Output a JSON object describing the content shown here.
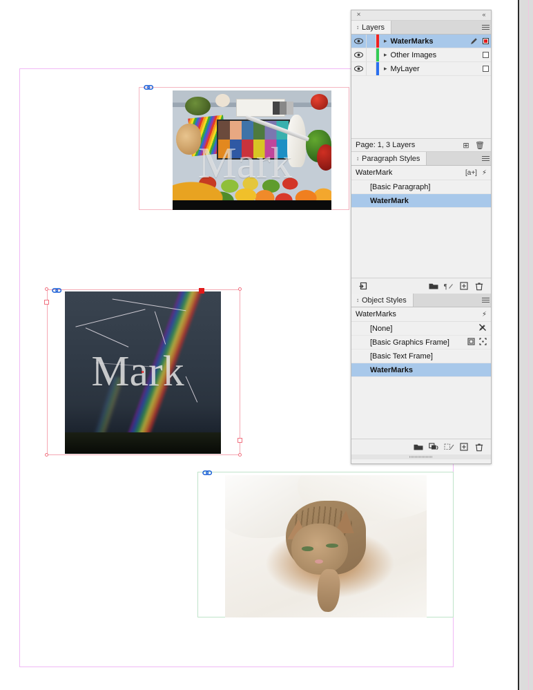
{
  "document": {
    "page_label": "Page: 1, 3 Layers"
  },
  "canvas": {
    "frames": [
      {
        "name": "food-colorchecker-image",
        "watermark": "Mark",
        "frame_color": "#f5b5c0"
      },
      {
        "name": "lightning-rainbow-image",
        "watermark": "Mark",
        "frame_color": "#f5a7b2"
      },
      {
        "name": "cat-on-bed-image",
        "watermark": "",
        "frame_color": "#bfe3c9"
      }
    ]
  },
  "panel": {
    "close_label": "×",
    "collapse_label": "«",
    "layers": {
      "tab_label": "Layers",
      "menu_icon": "hamburger-icon",
      "rows": [
        {
          "label": "WaterMarks",
          "color": "#ee2222",
          "selected": true,
          "visible": true,
          "has_pen": true,
          "target_filled": true
        },
        {
          "label": "Other Images",
          "color": "#33cc55",
          "selected": false,
          "visible": true,
          "has_pen": false,
          "target_filled": false
        },
        {
          "label": "MyLayer",
          "color": "#2a6ff0",
          "selected": false,
          "visible": true,
          "has_pen": false,
          "target_filled": false
        }
      ],
      "status": "Page: 1, 3 Layers",
      "new_layer_icon": "new-layer-icon",
      "delete_icon": "trash-icon"
    },
    "paragraph_styles": {
      "tab_label": "Paragraph Styles",
      "menu_icon": "hamburger-icon",
      "current_style": "WaterMark",
      "header_icons": [
        "[a+]",
        "⚡"
      ],
      "rows": [
        {
          "label": "[Basic Paragraph]",
          "selected": false
        },
        {
          "label": "WaterMark",
          "selected": true
        }
      ],
      "toolbar_icons": [
        "load-styles-icon",
        "new-group-icon",
        "clear-overrides-icon",
        "new-style-icon",
        "trash-icon"
      ]
    },
    "object_styles": {
      "tab_label": "Object Styles",
      "menu_icon": "hamburger-icon",
      "current_style": "WaterMarks",
      "header_icons": [
        "⚡"
      ],
      "rows": [
        {
          "label": "[None]",
          "selected": false,
          "icons": [
            "none-pen-icon"
          ]
        },
        {
          "label": "[Basic Graphics Frame]",
          "selected": false,
          "icons": [
            "graphics-frame-icon",
            "frame-select-icon"
          ]
        },
        {
          "label": "[Basic Text Frame]",
          "selected": false,
          "icons": []
        },
        {
          "label": "WaterMarks",
          "selected": true,
          "icons": []
        }
      ],
      "toolbar_icons": [
        "new-group-icon",
        "clear-attributes-icon",
        "clear-overrides-icon",
        "new-style-icon",
        "trash-icon"
      ]
    }
  }
}
